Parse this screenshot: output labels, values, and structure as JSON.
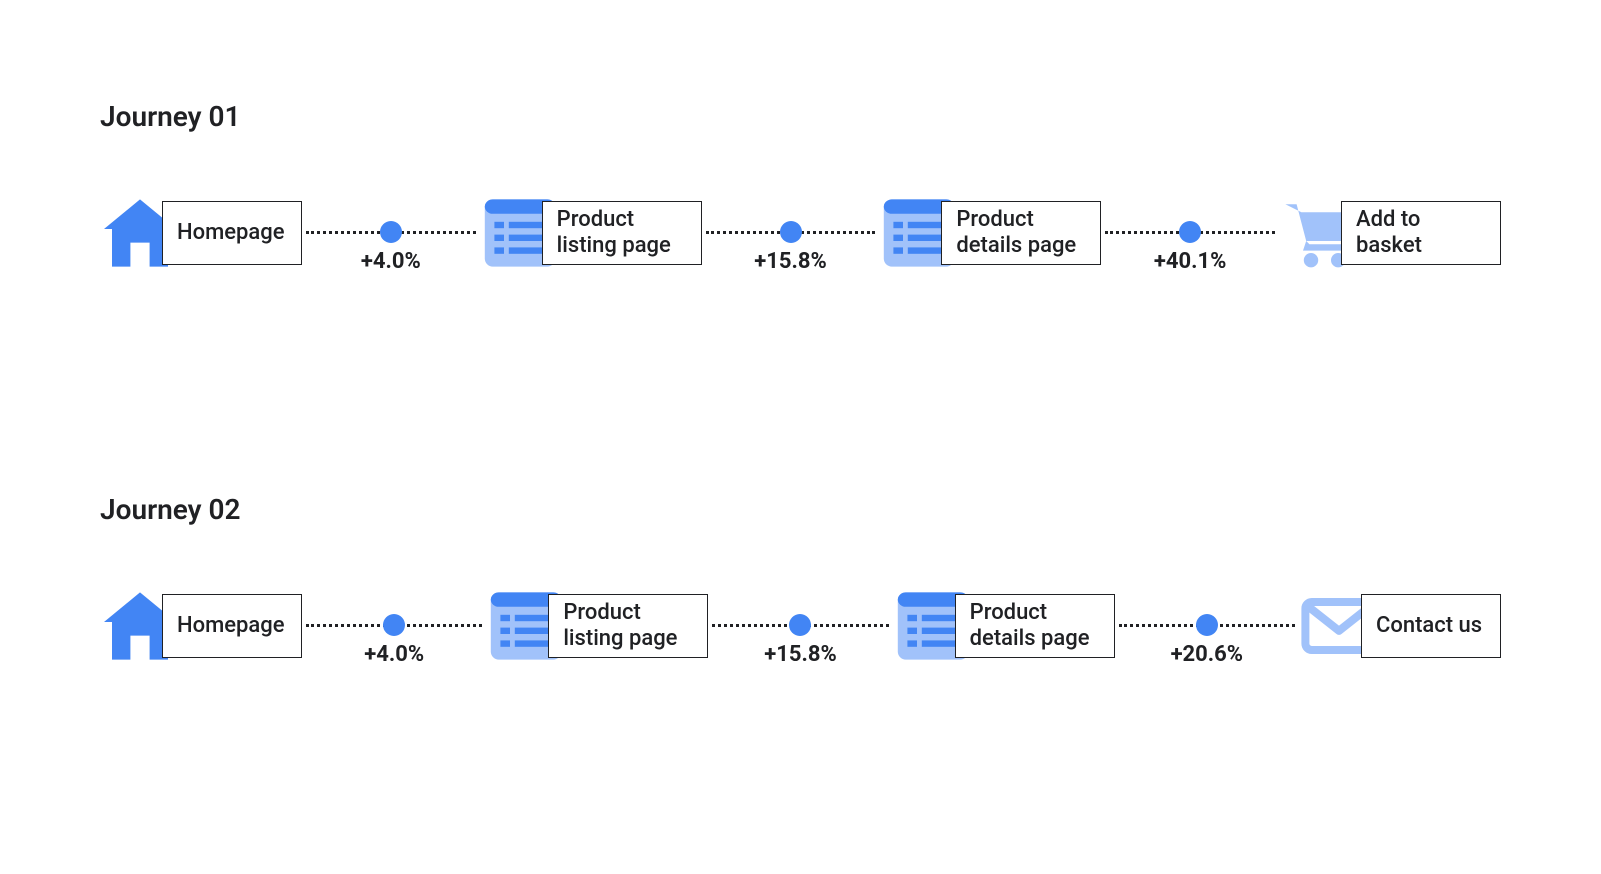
{
  "journeys": [
    {
      "title": "Journey 01",
      "steps": [
        {
          "icon": "home",
          "label": "Homepage"
        },
        {
          "icon": "list",
          "label": "Product listing page"
        },
        {
          "icon": "list",
          "label": "Product details page"
        },
        {
          "icon": "cart",
          "label": "Add to basket"
        }
      ],
      "connectors": [
        "+4.0%",
        "+15.8%",
        "+40.1%"
      ]
    },
    {
      "title": "Journey 02",
      "steps": [
        {
          "icon": "home",
          "label": "Homepage"
        },
        {
          "icon": "list",
          "label": "Product listing page"
        },
        {
          "icon": "list",
          "label": "Product details page"
        },
        {
          "icon": "mail",
          "label": "Contact us"
        }
      ],
      "connectors": [
        "+4.0%",
        "+15.8%",
        "+20.6%"
      ]
    }
  ],
  "colors": {
    "primary": "#4285f4",
    "light": "#a1c2fa",
    "text": "#202124"
  }
}
